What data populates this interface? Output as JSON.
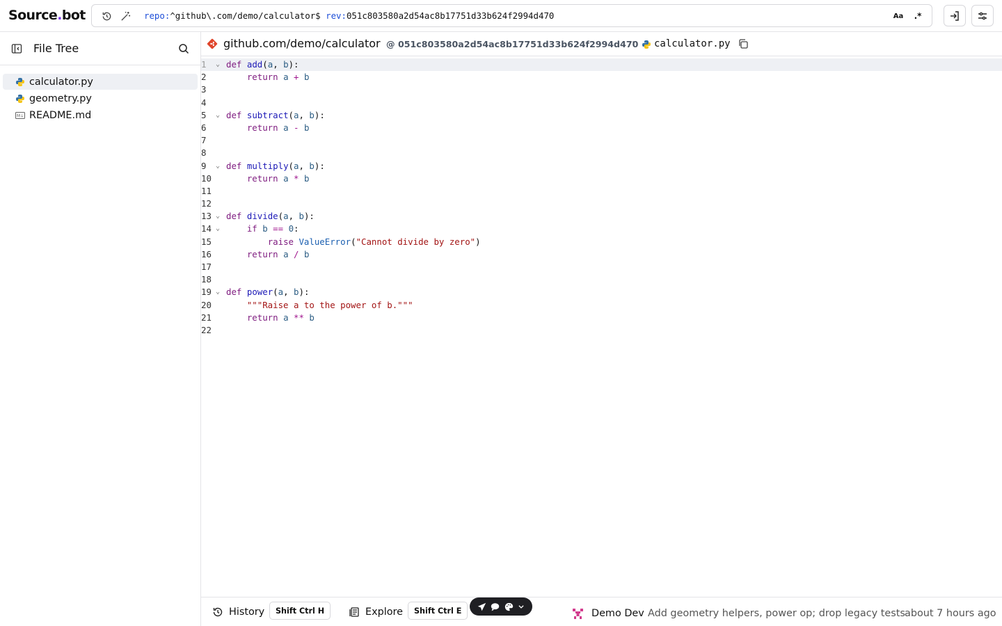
{
  "brand": {
    "name_part1": "Source",
    "name_part2": "bot",
    "dot": "."
  },
  "search": {
    "repo_key": "repo:",
    "repo_value": "^github\\.com/demo/calculator$",
    "rev_key": "rev:",
    "rev_value": "051c803580a2d54ac8b17751d33b624f2994d470",
    "case_toggle": "Aa",
    "regex_toggle": ".*"
  },
  "sidebar": {
    "title": "File Tree",
    "files": [
      {
        "name": "calculator.py",
        "type": "python",
        "active": true
      },
      {
        "name": "geometry.py",
        "type": "python",
        "active": false
      },
      {
        "name": "README.md",
        "type": "markdown",
        "active": false
      }
    ]
  },
  "path_bar": {
    "repo": "github.com/demo/calculator",
    "rev": "@ 051c803580a2d54ac8b17751d33b624f2994d470",
    "separator": "·",
    "file": "calculator.py"
  },
  "code": {
    "lines": [
      "def add(a, b):",
      "    return a + b",
      "",
      "",
      "def subtract(a, b):",
      "    return a - b",
      "",
      "",
      "def multiply(a, b):",
      "    return a * b",
      "",
      "",
      "def divide(a, b):",
      "    if b == 0:",
      "        raise ValueError(\"Cannot divide by zero\")",
      "    return a / b",
      "",
      "",
      "def power(a, b):",
      "    \"\"\"Raise a to the power of b.\"\"\"",
      "    return a ** b",
      ""
    ],
    "line_numbers": [
      "1",
      "2",
      "3",
      "4",
      "5",
      "6",
      "7",
      "8",
      "9",
      "10",
      "11",
      "12",
      "13",
      "14",
      "15",
      "16",
      "17",
      "18",
      "19",
      "20",
      "21",
      "22"
    ]
  },
  "bottom": {
    "history_label": "History",
    "history_shortcut": "Shift Ctrl H",
    "explore_label": "Explore",
    "explore_shortcut": "Shift Ctrl E",
    "commit_author": "Demo Dev",
    "commit_message": "Add geometry helpers, power op; drop legacy tests",
    "commit_time": "about 7 hours ago"
  },
  "colors": {
    "brand_accent": "#7c3aed",
    "keyword": "#7e1b7f",
    "function": "#1d1ab7",
    "string": "#a31515",
    "highlight_line": "#eef0f4"
  }
}
